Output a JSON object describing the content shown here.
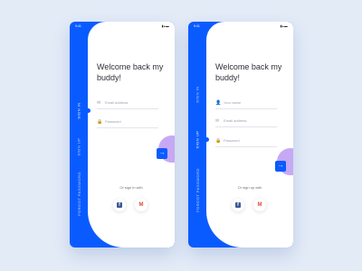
{
  "status": {
    "time": "9:41",
    "icons": "▮▴▬"
  },
  "colors": {
    "accent": "#0a5bff",
    "purple": "#c7a8f5",
    "background": "#e3ebf7"
  },
  "signin_screen": {
    "tabs": [
      {
        "label": "SIGN IN",
        "active": true
      },
      {
        "label": "SIGN UP",
        "active": false
      },
      {
        "label": "FORGOT PASSWORD",
        "active": false
      }
    ],
    "title": "Welcome back my buddy!",
    "fields": [
      {
        "icon": "mail-icon",
        "placeholder": "Email address"
      },
      {
        "icon": "lock-icon",
        "placeholder": "Password"
      }
    ],
    "submit_icon": "arrow-right-icon",
    "social_caption": "Or sign in with",
    "social": [
      {
        "icon": "facebook-icon",
        "glyph": "f"
      },
      {
        "icon": "gmail-icon",
        "glyph": "M"
      }
    ]
  },
  "signup_screen": {
    "tabs": [
      {
        "label": "SIGN IN",
        "active": false
      },
      {
        "label": "SIGN UP",
        "active": true
      },
      {
        "label": "FORGOT PASSWORD",
        "active": false
      }
    ],
    "title": "Welcome back my buddy!",
    "fields": [
      {
        "icon": "user-icon",
        "placeholder": "Your name"
      },
      {
        "icon": "mail-icon",
        "placeholder": "Email address"
      },
      {
        "icon": "lock-icon",
        "placeholder": "Password"
      }
    ],
    "submit_icon": "arrow-right-icon",
    "social_caption": "Or sign up with",
    "social": [
      {
        "icon": "facebook-icon",
        "glyph": "f"
      },
      {
        "icon": "gmail-icon",
        "glyph": "M"
      }
    ]
  }
}
